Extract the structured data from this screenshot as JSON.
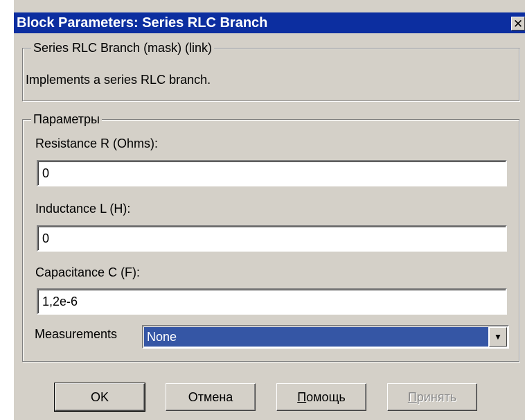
{
  "window": {
    "title": "Block Parameters: Series RLC Branch",
    "close_glyph": "✕"
  },
  "description": {
    "legend": "Series RLC Branch (mask) (link)",
    "text": "Implements a series RLC branch."
  },
  "parameters": {
    "legend": "Параметры",
    "resistance": {
      "label": "Resistance R (Ohms):",
      "value": "0"
    },
    "inductance": {
      "label": "Inductance L (H):",
      "value": "0"
    },
    "capacitance": {
      "label": "Capacitance C (F):",
      "value": "1,2e-6"
    },
    "measurements": {
      "label": "Measurements",
      "selected": "None",
      "arrow": "▼"
    }
  },
  "buttons": {
    "ok": "OK",
    "cancel": "Отмена",
    "help": "Помощь",
    "apply": "Принять"
  },
  "colors": {
    "titlebar": "#0c2ea0",
    "selection": "#3556a5",
    "face": "#d4d0c8"
  }
}
